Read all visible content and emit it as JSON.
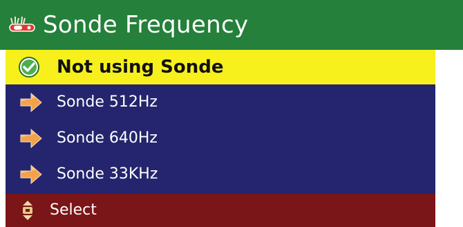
{
  "header": {
    "title": "Sonde Frequency",
    "icon": "sonde-tool-icon",
    "background": "#24803a"
  },
  "menu": {
    "background": "#24256e",
    "items": [
      {
        "label": "Not using Sonde",
        "icon": "checkmark-circle-icon",
        "selected": true
      },
      {
        "label": "Sonde 512Hz",
        "icon": "arrow-right-icon",
        "selected": false
      },
      {
        "label": "Sonde 640Hz",
        "icon": "arrow-right-icon",
        "selected": false
      },
      {
        "label": "Sonde 33KHz",
        "icon": "arrow-right-icon",
        "selected": false
      }
    ],
    "highlight_color": "#f7f01d"
  },
  "footer": {
    "label": "Select",
    "icon": "up-down-selector-icon",
    "background": "#7a1518"
  }
}
